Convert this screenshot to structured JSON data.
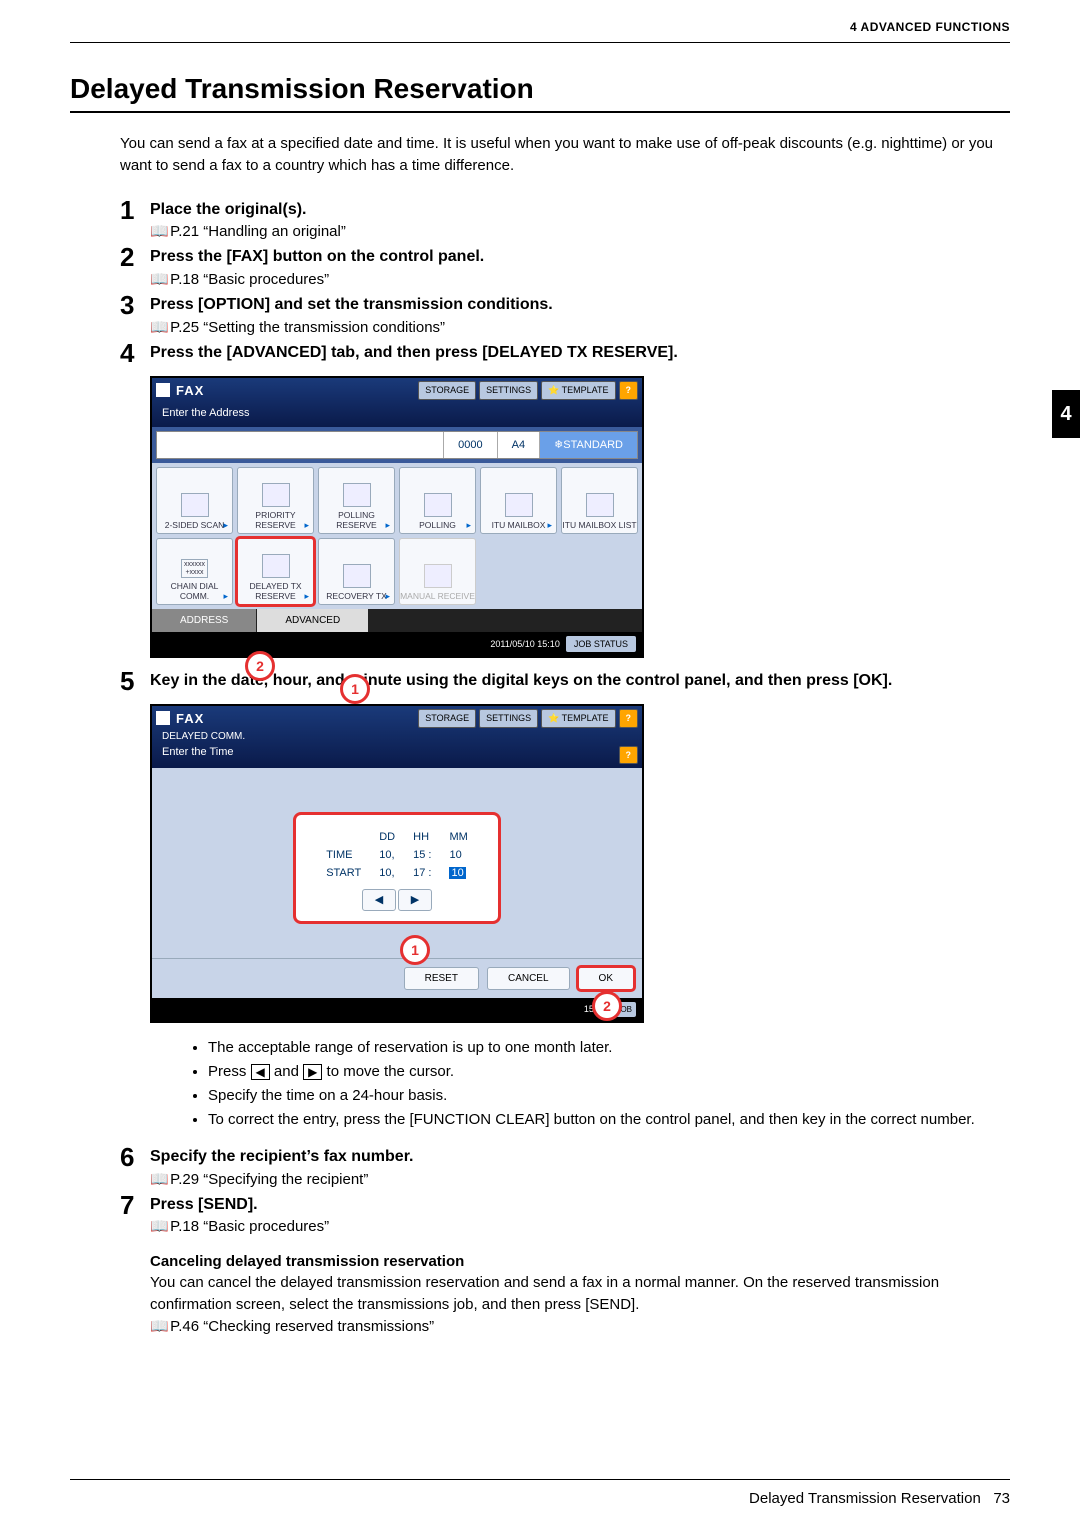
{
  "header": {
    "section": "4 ADVANCED FUNCTIONS"
  },
  "title": "Delayed Transmission Reservation",
  "intro": "You can send a fax at a specified date and time. It is useful when you want to make use of off-peak discounts (e.g. nighttime) or you want to send a fax to a country which has a time difference.",
  "side_tab": "4",
  "steps": [
    {
      "num": "1",
      "title": "Place the original(s).",
      "ref": "P.21 “Handling an original”"
    },
    {
      "num": "2",
      "title": "Press the [FAX] button on the control panel.",
      "ref": "P.18 “Basic procedures”"
    },
    {
      "num": "3",
      "title": "Press [OPTION] and set the transmission conditions.",
      "ref": "P.25 “Setting the transmission conditions”"
    },
    {
      "num": "4",
      "title": "Press the [ADVANCED] tab, and then press [DELAYED TX RESERVE]."
    },
    {
      "num": "5",
      "title": "Key in the date, hour, and minute using the digital keys on the control panel, and then press [OK]."
    },
    {
      "num": "6",
      "title": "Specify the recipient’s fax number.",
      "ref": "P.29 “Specifying the recipient”"
    },
    {
      "num": "7",
      "title": "Press [SEND].",
      "ref": "P.18 “Basic procedures”"
    }
  ],
  "panel1": {
    "title": "FAX",
    "top_buttons": [
      "STORAGE",
      "SETTINGS",
      "TEMPLATE"
    ],
    "help": "?",
    "subtitle": "Enter the Address",
    "status": {
      "count": "0000",
      "paper": "A4",
      "mode": "STANDARD"
    },
    "options_row1": [
      "2-SIDED SCAN",
      "PRIORITY RESERVE",
      "POLLING RESERVE",
      "POLLING",
      "ITU MAILBOX",
      "ITU MAILBOX LIST"
    ],
    "options_row2": [
      "CHAIN DIAL COMM.",
      "DELAYED TX RESERVE",
      "RECOVERY TX",
      "MANUAL RECEIVE"
    ],
    "tabs": [
      "ADDRESS",
      "ADVANCED"
    ],
    "timestamp": "2011/05/10 15:10",
    "job_status": "JOB STATUS",
    "callouts": [
      "1",
      "2"
    ]
  },
  "panel2": {
    "title": "FAX",
    "crumb": "DELAYED COMM.",
    "top_buttons": [
      "STORAGE",
      "SETTINGS",
      "TEMPLATE"
    ],
    "help": "?",
    "subtitle": "Enter the Time",
    "headers": [
      "DD",
      "HH",
      "MM"
    ],
    "rows": [
      {
        "label": "TIME",
        "dd": "10,",
        "hh": "15 :",
        "mm": "10"
      },
      {
        "label": "START",
        "dd": "10,",
        "hh": "17 :",
        "mm": "10"
      }
    ],
    "arrows": [
      "◀",
      "▶"
    ],
    "actions": [
      "RESET",
      "CANCEL",
      "OK"
    ],
    "foot_time": "15:10",
    "callouts": [
      "1",
      "2"
    ]
  },
  "bullets": [
    "The acceptable range of reservation is up to one month later.",
    "Press |◀| and |▶| to move the cursor.",
    "Specify the time on a 24-hour basis.",
    "To correct the entry, press the [FUNCTION CLEAR] button on the control panel, and then key in the correct number."
  ],
  "cancel": {
    "heading": "Canceling delayed transmission reservation",
    "body": "You can cancel the delayed transmission reservation and send a fax in a normal manner. On the reserved transmission confirmation screen, select the transmissions job, and then press [SEND].",
    "ref": "P.46 “Checking reserved transmissions”"
  },
  "footer": {
    "title": "Delayed Transmission Reservation",
    "page": "73"
  }
}
